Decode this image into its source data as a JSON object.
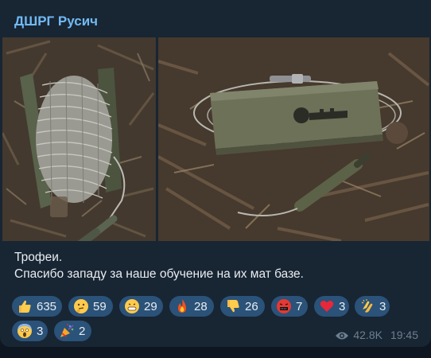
{
  "channel": {
    "name": "ДШРГ Русич"
  },
  "caption": {
    "line1": "Трофеи.",
    "line2": "Спасибо западу за наше обучение на их мат базе."
  },
  "reactions": [
    {
      "icon": "thumbs-up-icon",
      "count": "635"
    },
    {
      "icon": "thinking-face-icon",
      "count": "59"
    },
    {
      "icon": "grinning-face-icon",
      "count": "29"
    },
    {
      "icon": "fire-icon",
      "count": "28"
    },
    {
      "icon": "thumbs-down-icon",
      "count": "26"
    },
    {
      "icon": "swearing-face-icon",
      "count": "7"
    },
    {
      "icon": "red-heart-icon",
      "count": "3"
    },
    {
      "icon": "clapping-hands-icon",
      "count": "3"
    },
    {
      "icon": "screaming-face-icon",
      "count": "3"
    },
    {
      "icon": "party-popper-icon",
      "count": "2"
    }
  ],
  "meta": {
    "views": "42.8K",
    "time": "19:45"
  },
  "colors": {
    "background": "#0e1621",
    "bubble": "#182533",
    "channel_name": "#71baf4",
    "reaction_pill": "#2b5278",
    "meta_text": "#6d7f8f"
  }
}
